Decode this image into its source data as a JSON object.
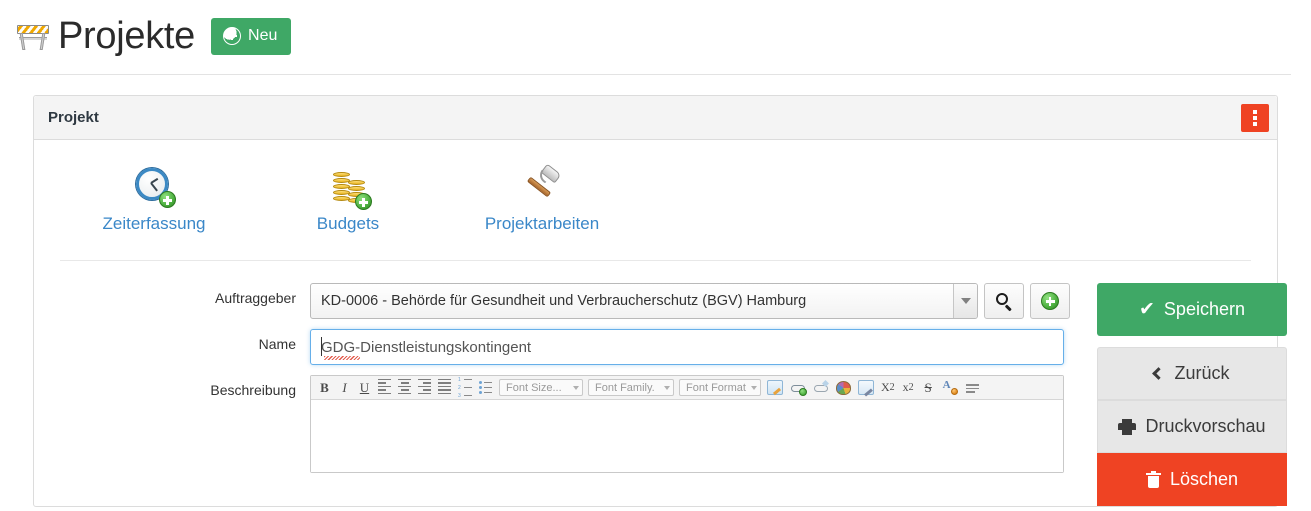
{
  "header": {
    "icon": "construction-barrier-icon",
    "title": "Projekte",
    "new_button": {
      "label": "Neu",
      "icon": "plus-circle-icon",
      "color": "#3fa866"
    }
  },
  "panel": {
    "title": "Projekt",
    "menu_button": {
      "icon": "vertical-ellipsis-icon",
      "color": "#ef4323"
    }
  },
  "shortcuts": [
    {
      "label": "Zeiterfassung",
      "icon": "clock-add-icon"
    },
    {
      "label": "Budgets",
      "icon": "coins-add-icon"
    },
    {
      "label": "Projektarbeiten",
      "icon": "hammer-icon"
    }
  ],
  "form": {
    "auftraggeber": {
      "label": "Auftraggeber",
      "value": "KD-0006 - Behörde für Gesundheit und Verbraucherschutz (BGV) Hamburg",
      "search_icon": "search-icon",
      "add_icon": "plus-circle-icon"
    },
    "name": {
      "label": "Name",
      "value": "GDG-Dienstleistungskontingent",
      "placeholder": "",
      "focused": true,
      "spellcheck_word": "GDG"
    },
    "beschreibung": {
      "label": "Beschreibung",
      "value": "",
      "toolbar": {
        "bold": "B",
        "italic": "I",
        "underline": "U",
        "align_left": "align-left-icon",
        "align_center": "align-center-icon",
        "align_right": "align-right-icon",
        "align_justify": "align-justify-icon",
        "list_ordered": "ordered-list-icon",
        "list_unordered": "unordered-list-icon",
        "font_size": "Font Size...",
        "font_family": "Font Family.",
        "font_format": "Font Format",
        "insert_note": "insert-note-icon",
        "insert_link": "insert-link-icon",
        "remove_link": "remove-link-icon",
        "color_palette": "color-palette-icon",
        "edit_image": "edit-image-icon",
        "subscript": "X",
        "subscript_num": "2",
        "superscript": "x",
        "superscript_num": "2",
        "strikethrough": "S",
        "text_color": "text-color-icon",
        "horizontal_rule": "horizontal-rule-icon"
      }
    }
  },
  "actions": [
    {
      "label": "Speichern",
      "icon": "check-icon",
      "style": "save",
      "color": "#3fa866"
    },
    {
      "label": "Zurück",
      "icon": "chevron-left-icon",
      "style": "gray"
    },
    {
      "label": "Druckvorschau",
      "icon": "printer-icon",
      "style": "gray"
    },
    {
      "label": "Löschen",
      "icon": "trash-icon",
      "style": "delete",
      "color": "#ef4323"
    }
  ]
}
